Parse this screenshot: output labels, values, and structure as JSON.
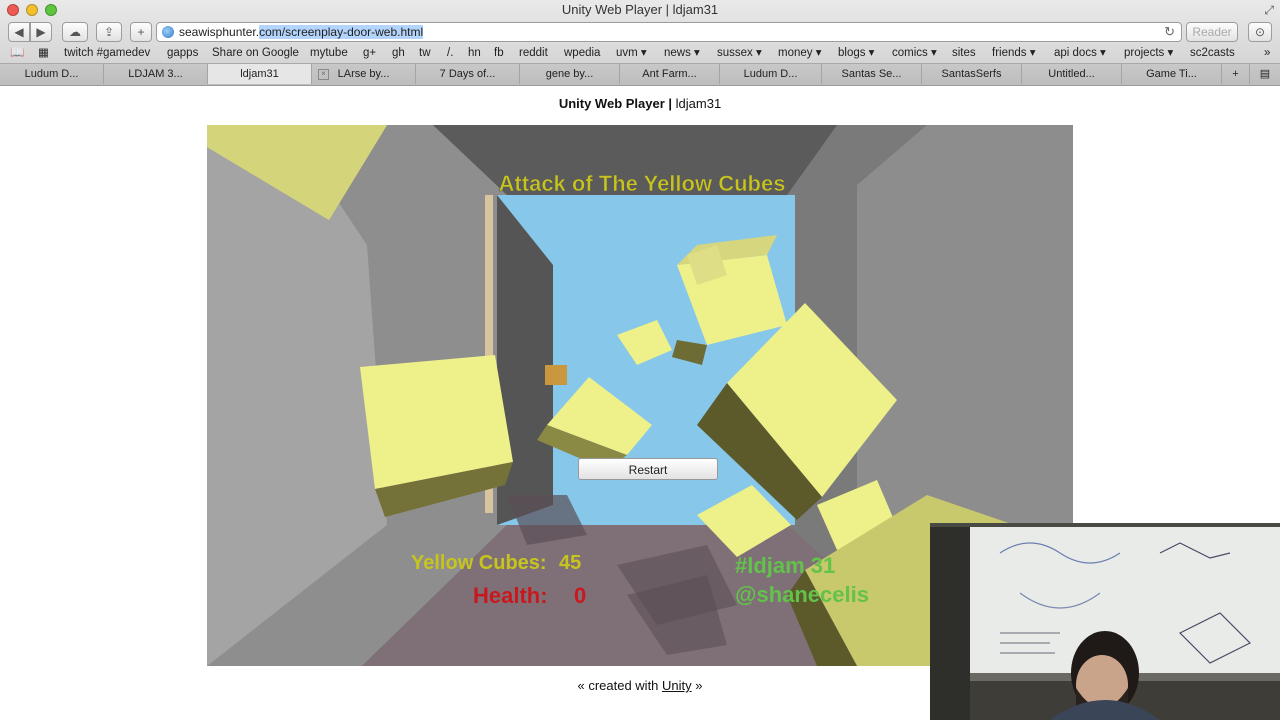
{
  "window": {
    "title": "Unity Web Player | ldjam31"
  },
  "toolbar": {
    "back_icon": "back-arrow-icon",
    "forward_icon": "forward-arrow-icon",
    "url_host": "seawisphunter.",
    "url_rest": "com/screenplay-door-web.html",
    "reader_label": "Reader"
  },
  "bookmarks": [
    "twitch #gamedev",
    "gapps",
    "Share on Google",
    "mytube",
    "g+",
    "gh",
    "tw",
    "/.",
    "hn",
    "fb",
    "reddit",
    "wpedia",
    "uvm ▾",
    "news ▾",
    "sussex ▾",
    "money ▾",
    "blogs ▾",
    "comics ▾",
    "sites",
    "friends ▾",
    "api docs ▾",
    "projects ▾",
    "sc2casts"
  ],
  "tabs": [
    "Ludum D...",
    "LDJAM 3...",
    "ldjam31",
    "LArse by...",
    "7 Days of...",
    "gene by...",
    "Ant Farm...",
    "Ludum D...",
    "Santas Se...",
    "SantasSerfs",
    "Untitled...",
    "Game Ti..."
  ],
  "page": {
    "heading_bold": "Unity Web Player |",
    "heading_rest": " ldjam31",
    "footer_prefix": "« created with ",
    "footer_link": "Unity",
    "footer_suffix": " »"
  },
  "game": {
    "title": "Attack of The Yellow Cubes",
    "restart_label": "Restart",
    "cubes_label": "Yellow Cubes:",
    "cubes_value": "45",
    "health_label": "Health:",
    "health_value": "0",
    "tag1": "#ldjam 31",
    "tag2": "@shanecelis",
    "colors": {
      "cube": "#eef08a",
      "title": "#c8c41e",
      "health": "#c8181e",
      "tag": "#63c24a",
      "sky": "#86c7ea"
    }
  }
}
